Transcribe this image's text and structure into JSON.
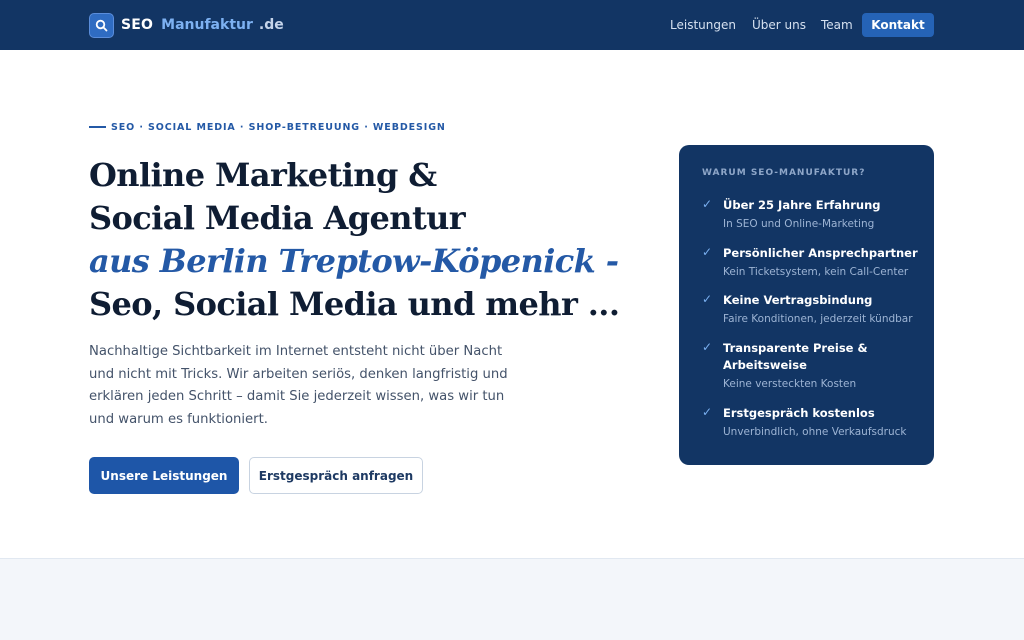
{
  "header": {
    "logo": {
      "part1": "SEO",
      "part2": "Manufaktur",
      "part3": ".de",
      "icon": "search-icon"
    },
    "nav": [
      "Leistungen",
      "Über uns",
      "Team"
    ],
    "cta": "Kontakt"
  },
  "hero": {
    "eyebrow": "SEO · SOCIAL MEDIA · SHOP-BETREUUNG · WEBDESIGN",
    "headline": {
      "line1": "Online Marketing &",
      "line2": "Social Media Agentur",
      "line3": "aus Berlin Treptow-Köpenick -",
      "line4": "Seo, Social Media und mehr ..."
    },
    "lead": "Nachhaltige Sichtbarkeit im Internet entsteht nicht über Nacht und nicht mit Tricks. Wir arbeiten seriös, denken langfristig und erklären jeden Schritt – damit Sie jederzeit wissen, was wir tun und warum es funktioniert.",
    "primary_button": "Unsere Leistungen",
    "secondary_button": "Erstgespräch anfragen"
  },
  "card": {
    "title": "WARUM SEO-MANUFAKTUR?",
    "check_icon": "check-icon",
    "items": [
      {
        "title": "Über 25 Jahre Erfahrung",
        "sub": "In SEO und Online-Marketing"
      },
      {
        "title": "Persönlicher Ansprechpartner",
        "sub": "Kein Ticketsystem, kein Call-Center"
      },
      {
        "title": "Keine Vertragsbindung",
        "sub": "Faire Konditionen, jederzeit kündbar"
      },
      {
        "title": "Transparente Preise & Arbeitsweise",
        "sub": "Keine versteckten Kosten"
      },
      {
        "title": "Erstgespräch kostenlos",
        "sub": "Unverbindlich, ohne Verkaufsdruck"
      }
    ]
  },
  "colors": {
    "navy": "#123564",
    "accent": "#2459a6",
    "button": "#1e56a8",
    "light_blue": "#7db1f2"
  }
}
